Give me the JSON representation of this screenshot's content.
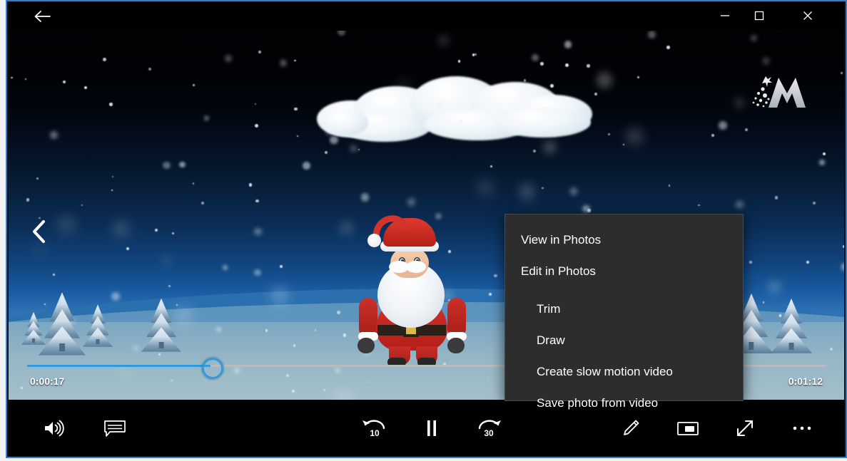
{
  "window": {
    "back_label": "Back",
    "minimize_label": "Minimize",
    "maximize_label": "Maximize",
    "close_label": "Close"
  },
  "video": {
    "watermark": "MiniTool",
    "santa_logo": "MiniTool",
    "prev_label": "Previous"
  },
  "player": {
    "current_time": "0:00:17",
    "duration": "0:01:12",
    "progress_percent": 23,
    "accent_color": "#2f9ade",
    "rewind_seconds": "10",
    "forward_seconds": "30",
    "state": "playing",
    "controls": {
      "volume": "volume-icon",
      "captions": "captions-icon",
      "rewind": "rewind-10-icon",
      "play_pause": "pause-icon",
      "forward": "forward-30-icon",
      "edit": "pencil-icon",
      "mini_player": "mini-player-icon",
      "fullscreen": "fullscreen-icon",
      "more": "more-options-icon"
    }
  },
  "context_menu": {
    "background_color": "#2d2d2d",
    "items": [
      {
        "label": "View in Photos",
        "level": 0
      },
      {
        "label": "Edit in Photos",
        "level": 0
      },
      {
        "label": "Trim",
        "level": 1
      },
      {
        "label": "Draw",
        "level": 1
      },
      {
        "label": "Create slow motion video",
        "level": 1
      },
      {
        "label": "Save photo from video",
        "level": 1
      }
    ]
  }
}
